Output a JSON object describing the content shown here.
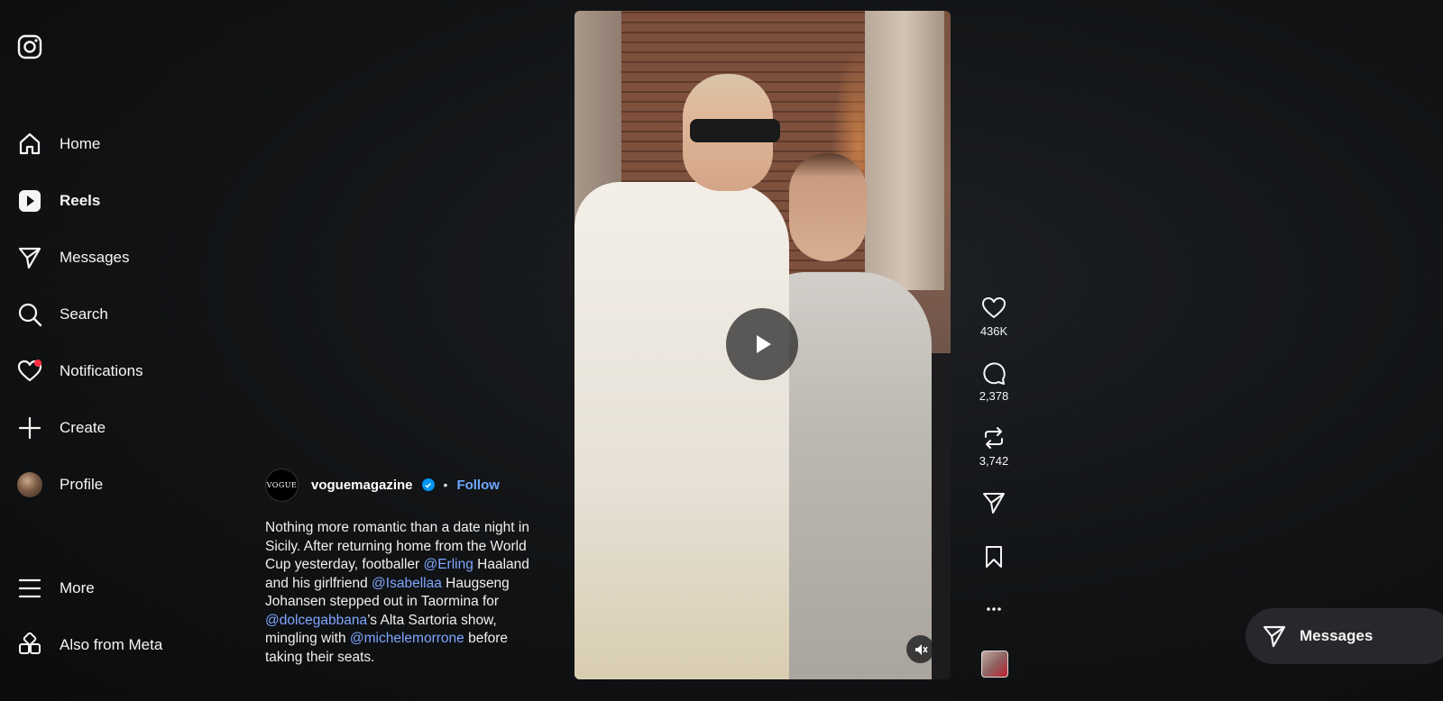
{
  "sidebar": {
    "items": [
      {
        "label": "Home",
        "icon": "home-icon"
      },
      {
        "label": "Reels",
        "icon": "reels-icon",
        "active": true
      },
      {
        "label": "Messages",
        "icon": "paper-plane-icon"
      },
      {
        "label": "Search",
        "icon": "search-icon"
      },
      {
        "label": "Notifications",
        "icon": "heart-icon",
        "badge": true
      },
      {
        "label": "Create",
        "icon": "plus-icon"
      },
      {
        "label": "Profile",
        "icon": "avatar"
      },
      {
        "label": "More",
        "icon": "menu-icon"
      },
      {
        "label": "Also from Meta",
        "icon": "grid-icon"
      }
    ]
  },
  "post": {
    "account_logo_text": "VOGUE",
    "account": "voguemagazine",
    "separator": "•",
    "follow_label": "Follow",
    "caption": {
      "p1": "Nothing more romantic than a date night in Sicily. After returning home from the World Cup yesterday, footballer ",
      "m1": "@Erling",
      "p2": " Haaland and his girlfriend ",
      "m2": "@Isabellaa",
      "p3": " Haugseng Johansen stepped out in Taormina for ",
      "m3": "@dolcegabbana",
      "p4": "’s Alta Sartoria show, mingling with ",
      "m4": "@michelemorrone",
      "p5": " before taking their seats."
    }
  },
  "actions": {
    "likes": "436K",
    "comments": "2,378",
    "reposts": "3,742"
  },
  "messages_pill": {
    "label": "Messages"
  },
  "colors": {
    "accent": "#0095f6",
    "mention": "#7fa6ff",
    "notification": "#ff3040"
  }
}
